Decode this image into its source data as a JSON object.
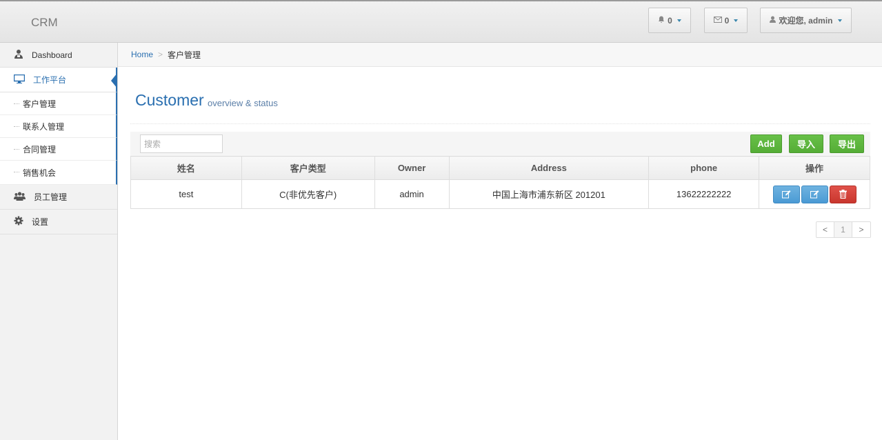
{
  "app": {
    "brand": "CRM"
  },
  "navbar": {
    "notifications_count": "0",
    "messages_count": "0",
    "user_label": "欢迎您, admin"
  },
  "sidebar": {
    "items": [
      {
        "label": "Dashboard",
        "icon": "dashboard-icon"
      },
      {
        "label": "工作平台",
        "icon": "monitor-icon",
        "active": true
      },
      {
        "label": "员工管理",
        "icon": "users-icon"
      },
      {
        "label": "设置",
        "icon": "gear-icon"
      }
    ],
    "sub_items": [
      {
        "label": "客户管理"
      },
      {
        "label": "联系人管理"
      },
      {
        "label": "合同管理"
      },
      {
        "label": "销售机会"
      }
    ]
  },
  "breadcrumb": {
    "home": "Home",
    "separator": ">",
    "current": "客户管理"
  },
  "page": {
    "title": "Customer",
    "subtitle": "overview & status"
  },
  "toolbar": {
    "search_placeholder": "搜索",
    "add_label": "Add",
    "import_label": "导入",
    "export_label": "导出"
  },
  "table": {
    "columns": [
      "姓名",
      "客户类型",
      "Owner",
      "Address",
      "phone",
      "操作"
    ],
    "rows": [
      {
        "name": "test",
        "type": "C(非优先客户)",
        "owner": "admin",
        "address": "中国上海市浦东新区 201201",
        "phone": "13622222222"
      }
    ]
  },
  "pagination": {
    "prev": "<",
    "current": "1",
    "next": ">"
  },
  "colors": {
    "accent": "#2a6fb0",
    "green": "#5cb53c",
    "blue_action": "#5aa5db",
    "red_action": "#d54338"
  }
}
